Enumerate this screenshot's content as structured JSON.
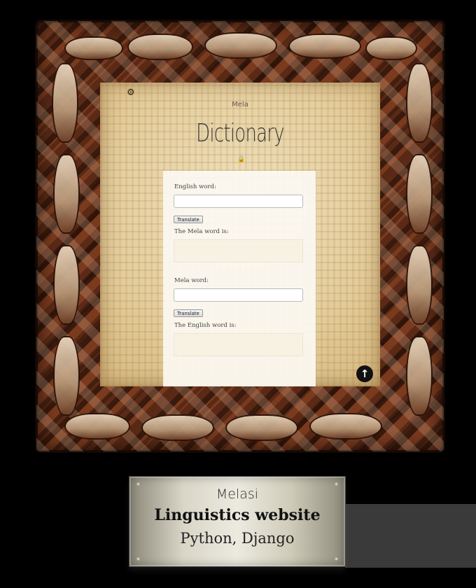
{
  "app": {
    "brand": "Mela",
    "title": "Dictionary"
  },
  "icons": {
    "settings": "gear-icon",
    "lock": "lock-icon",
    "scroll_top": "arrow-up-circle-icon"
  },
  "form_english_to_mela": {
    "label": "English word:",
    "input_value": "",
    "button_label": "Translate",
    "result_label": "The Mela word is:",
    "result_value": ""
  },
  "form_mela_to_english": {
    "label": "Mela word:",
    "input_value": "",
    "button_label": "Translate",
    "result_label": "The English word is:",
    "result_value": ""
  },
  "plaque": {
    "line1": "Melasi",
    "line2": "Linguistics website",
    "line3": "Python, Django"
  },
  "colors": {
    "frame_wood": "#4a2414",
    "parchment": "#e4cf9f",
    "plaque_metal": "#d9d6c8",
    "background": "#000000"
  }
}
